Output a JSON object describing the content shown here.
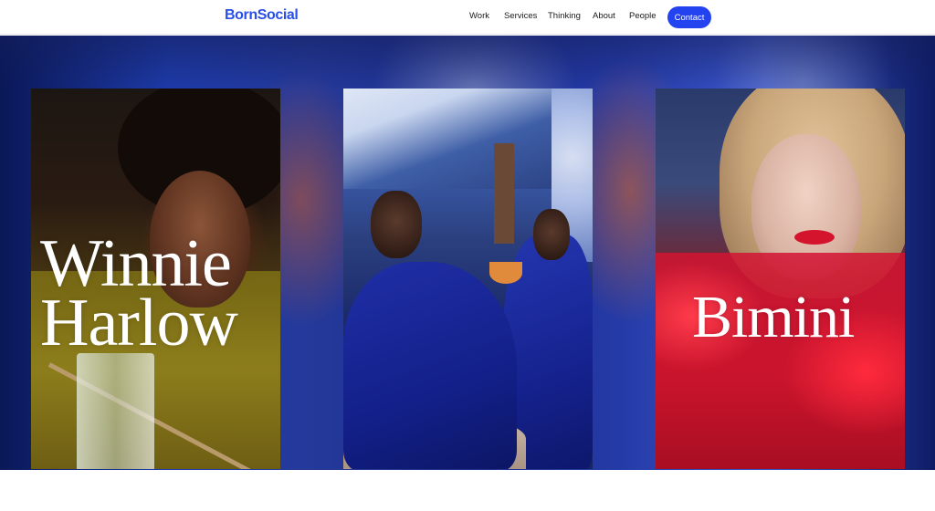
{
  "header": {
    "logo": "BornSocial",
    "nav": {
      "work": "Work",
      "services": "Services",
      "thinking": "Thinking",
      "about": "About",
      "people": "People"
    },
    "contact_label": "Contact"
  },
  "colors": {
    "brand_blue": "#2a4ee8",
    "contact_button": "#2343f0"
  },
  "cards": [
    {
      "title_line1": "Winnie",
      "title_line2": "Harlow"
    },
    {
      "title_line1": "",
      "title_line2": ""
    },
    {
      "title_line1": "Bimini",
      "title_line2": ""
    }
  ]
}
